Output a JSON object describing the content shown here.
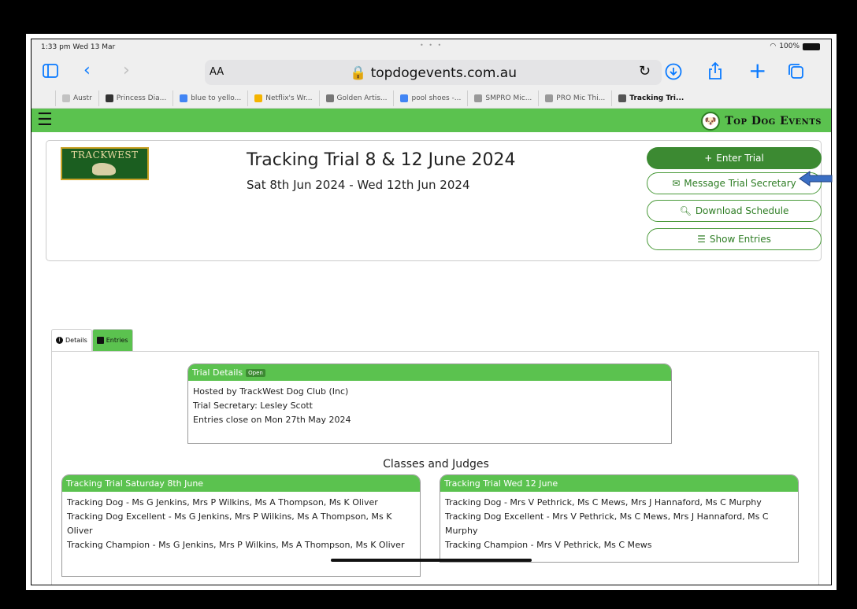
{
  "status": {
    "time": "1:33 pm  Wed 13 Mar",
    "battery": "100%"
  },
  "toolbar": {
    "aa": "AA",
    "url": "topdogevents.com.au"
  },
  "tabs": [
    {
      "label": "Austr",
      "color": "#c2c2c2"
    },
    {
      "label": "Princess Dia...",
      "color": "#333333"
    },
    {
      "label": "blue to yello...",
      "color": "#4285f4"
    },
    {
      "label": "Netflix's Wr...",
      "color": "#f4b400"
    },
    {
      "label": "Golden Artis...",
      "color": "#777777"
    },
    {
      "label": "pool shoes -...",
      "color": "#4285f4"
    },
    {
      "label": "SMPRO Mic...",
      "color": "#999999"
    },
    {
      "label": "PRO Mic Thi...",
      "color": "#999999"
    },
    {
      "label": "Tracking Tri...",
      "color": "#555555"
    }
  ],
  "site": {
    "brand": "Top Dog Events"
  },
  "club": {
    "logo_text": "TRACKWEST"
  },
  "event": {
    "title": "Tracking Trial 8 & 12 June 2024",
    "dates": "Sat 8th Jun 2024 - Wed 12th Jun 2024"
  },
  "buttons": {
    "enter": "Enter Trial",
    "message": "Message Trial Secretary",
    "download": "Download Schedule",
    "show": "Show Entries"
  },
  "page_tabs": {
    "details": "Details",
    "entries": "Entries"
  },
  "trial_details": {
    "heading": "Trial Details",
    "badge": "Open",
    "lines": [
      "Hosted by TrackWest Dog Club (Inc)",
      "Trial Secretary: Lesley Scott",
      "Entries close on Mon 27th May 2024"
    ]
  },
  "classes_heading": "Classes and Judges",
  "class_cards": [
    {
      "heading": "Tracking Trial Saturday 8th June",
      "lines": [
        "Tracking Dog - Ms G Jenkins, Mrs P Wilkins, Ms A Thompson, Ms K Oliver",
        "Tracking Dog Excellent - Ms G Jenkins, Mrs P Wilkins, Ms A Thompson, Ms K Oliver",
        "Tracking Champion - Ms G Jenkins, Mrs P Wilkins, Ms A Thompson, Ms K Oliver"
      ]
    },
    {
      "heading": "Tracking Trial Wed 12 June",
      "lines": [
        "Tracking Dog - Mrs V Pethrick, Ms C Mews, Mrs J Hannaford, Ms C Murphy",
        "Tracking Dog Excellent - Mrs V Pethrick, Ms C Mews, Mrs J Hannaford, Ms C Murphy",
        "Tracking Champion - Mrs V Pethrick, Ms C Mews"
      ]
    }
  ],
  "colors": {
    "brand_green": "#5bc24f",
    "button_green": "#3c8a32",
    "ios_blue": "#0a7aff",
    "arrow_blue": "#3b6fc4"
  }
}
